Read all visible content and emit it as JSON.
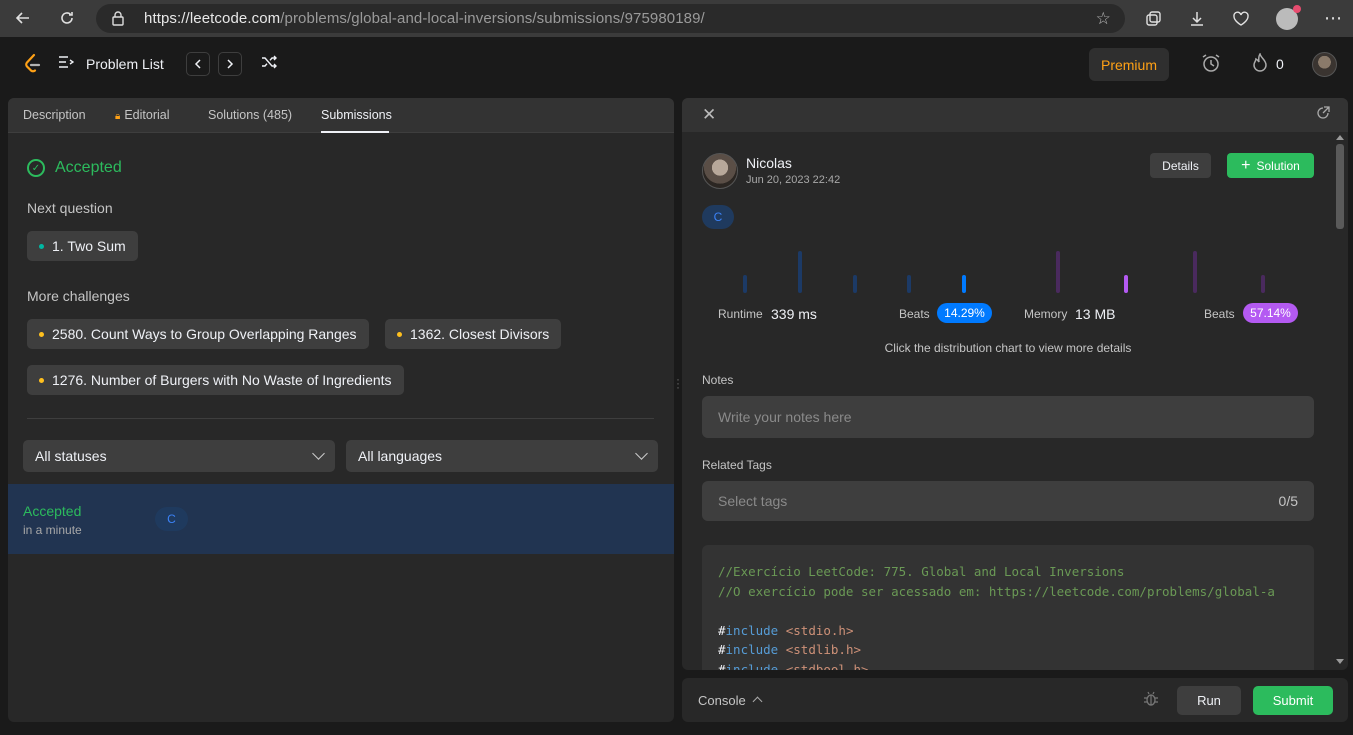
{
  "browser": {
    "url_host": "https://leetcode.com",
    "url_path": "/problems/global-and-local-inversions/submissions/975980189/"
  },
  "navbar": {
    "problem_list": "Problem List",
    "premium": "Premium",
    "streak_count": "0"
  },
  "left_tabs": [
    {
      "label": "Description"
    },
    {
      "label": "Editorial"
    },
    {
      "label": "Solutions (485)"
    },
    {
      "label": "Submissions"
    }
  ],
  "result": {
    "status": "Accepted",
    "next_question_label": "Next question",
    "next_question": "1. Two Sum",
    "more_challenges_label": "More challenges",
    "challenges": [
      {
        "title": "2580. Count Ways to Group Overlapping Ranges"
      },
      {
        "title": "1362. Closest Divisors"
      },
      {
        "title": "1276. Number of Burgers with No Waste of Ingredients"
      }
    ]
  },
  "filters": {
    "status": "All statuses",
    "language": "All languages"
  },
  "submission_row": {
    "status": "Accepted",
    "time": "in a minute",
    "lang": "C"
  },
  "detail": {
    "user_name": "Nicolas",
    "date": "Jun 20, 2023 22:42",
    "details_btn": "Details",
    "solution_btn": "Solution",
    "lang": "C",
    "runtime_label": "Runtime",
    "runtime_value": "339 ms",
    "runtime_beats_label": "Beats",
    "runtime_beats": "14.29%",
    "memory_label": "Memory",
    "memory_value": "13 MB",
    "memory_beats_label": "Beats",
    "memory_beats": "57.14%",
    "hint": "Click the distribution chart to view more details",
    "notes_label": "Notes",
    "notes_placeholder": "Write your notes here",
    "tags_label": "Related Tags",
    "tags_placeholder": "Select tags",
    "tags_count": "0/5",
    "code": {
      "line1": "//Exercício LeetCode: 775. Global and Local Inversions",
      "line2": "//O exercício pode ser acessado em: https://leetcode.com/problems/global-a",
      "inc1": "<stdio.h>",
      "inc2": "<stdlib.h>",
      "inc3": "<stdbool.h>",
      "hash": "#",
      "include": "include"
    }
  },
  "console": {
    "label": "Console",
    "run": "Run",
    "submit": "Submit"
  },
  "colors": {
    "accent_green": "#2cbb5d",
    "premium_orange": "#ffa116",
    "runtime_blue": "#007aff",
    "memory_purple": "#b45af2"
  }
}
